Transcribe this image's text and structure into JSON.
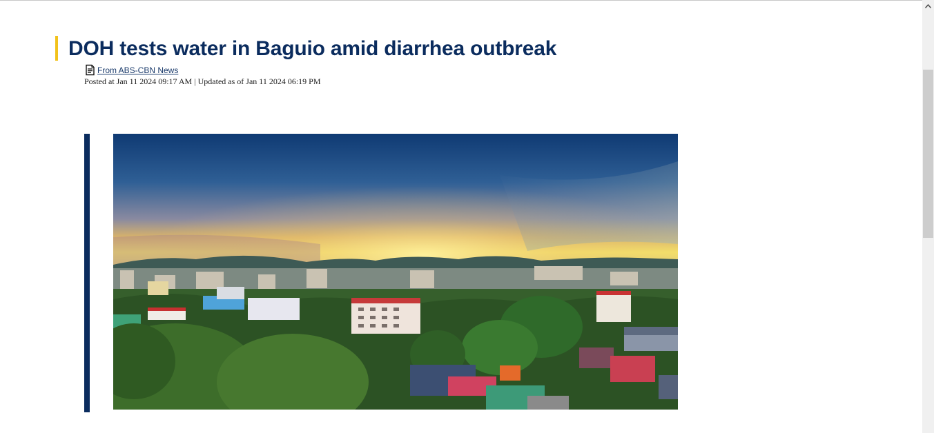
{
  "article": {
    "headline": "DOH tests water in Baguio amid diarrhea outbreak",
    "source_label": "From ABS-CBN News",
    "dateline": "Posted at Jan 11 2024 09:17 AM | Updated as of Jan 11 2024 06:19 PM"
  },
  "colors": {
    "headline": "#0b2c5e",
    "accent_bar": "#f2c21b",
    "photo_bar": "#0b2c5e"
  },
  "icons": {
    "source": "document-icon",
    "scroll_up": "chevron-up-icon"
  }
}
